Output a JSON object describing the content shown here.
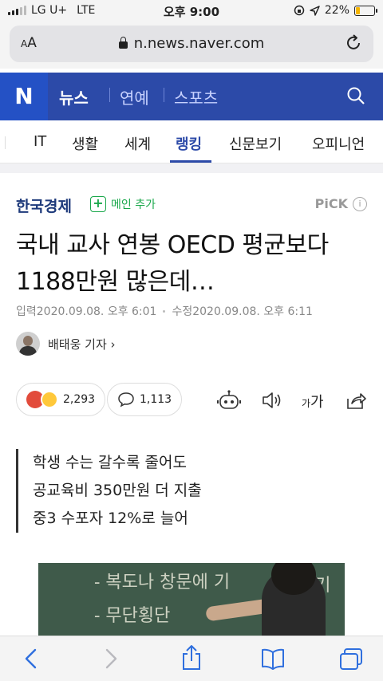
{
  "status_bar": {
    "carrier": "LG U+",
    "network": "LTE",
    "time": "오후 9:00",
    "battery": "22%",
    "battery_level": 0.22
  },
  "browser": {
    "text_size_label_small": "A",
    "text_size_label_big": "A",
    "url": "n.news.naver.com"
  },
  "header": {
    "logo": "N",
    "sections": [
      "뉴스",
      "연예",
      "스포츠"
    ]
  },
  "tabs": {
    "items": [
      "IT",
      "생활",
      "세계",
      "랭킹",
      "신문보기",
      "오피니언"
    ],
    "active": "랭킹"
  },
  "article": {
    "press": "한국경제",
    "main_add_label": "메인 추가",
    "pick_label": "PiCK",
    "title_line1": "국내 교사 연봉 OECD 평균보다",
    "title_line2": "1188만원 많은데…",
    "input_date": "입력2020.09.08. 오후 6:01",
    "modified_date": "수정2020.09.08. 오후 6:11",
    "reporter": "배태웅 기자 ›",
    "reactions_count": "2,293",
    "comments_count": "1,113",
    "font_size_label_small": "가",
    "font_size_label_big": "가",
    "summary": [
      "학생 수는 갈수록 줄어도",
      "공교육비 350만원 더 지출",
      "중3 수포자 12%로 늘어"
    ],
    "photo_chalk": [
      "- 복도나 창문에 기",
      "않기",
      "- 무단횡단"
    ]
  },
  "colors": {
    "naver_blue": "#2c4aa8",
    "green": "#19a74a",
    "ios_blue": "#2f6fde"
  }
}
